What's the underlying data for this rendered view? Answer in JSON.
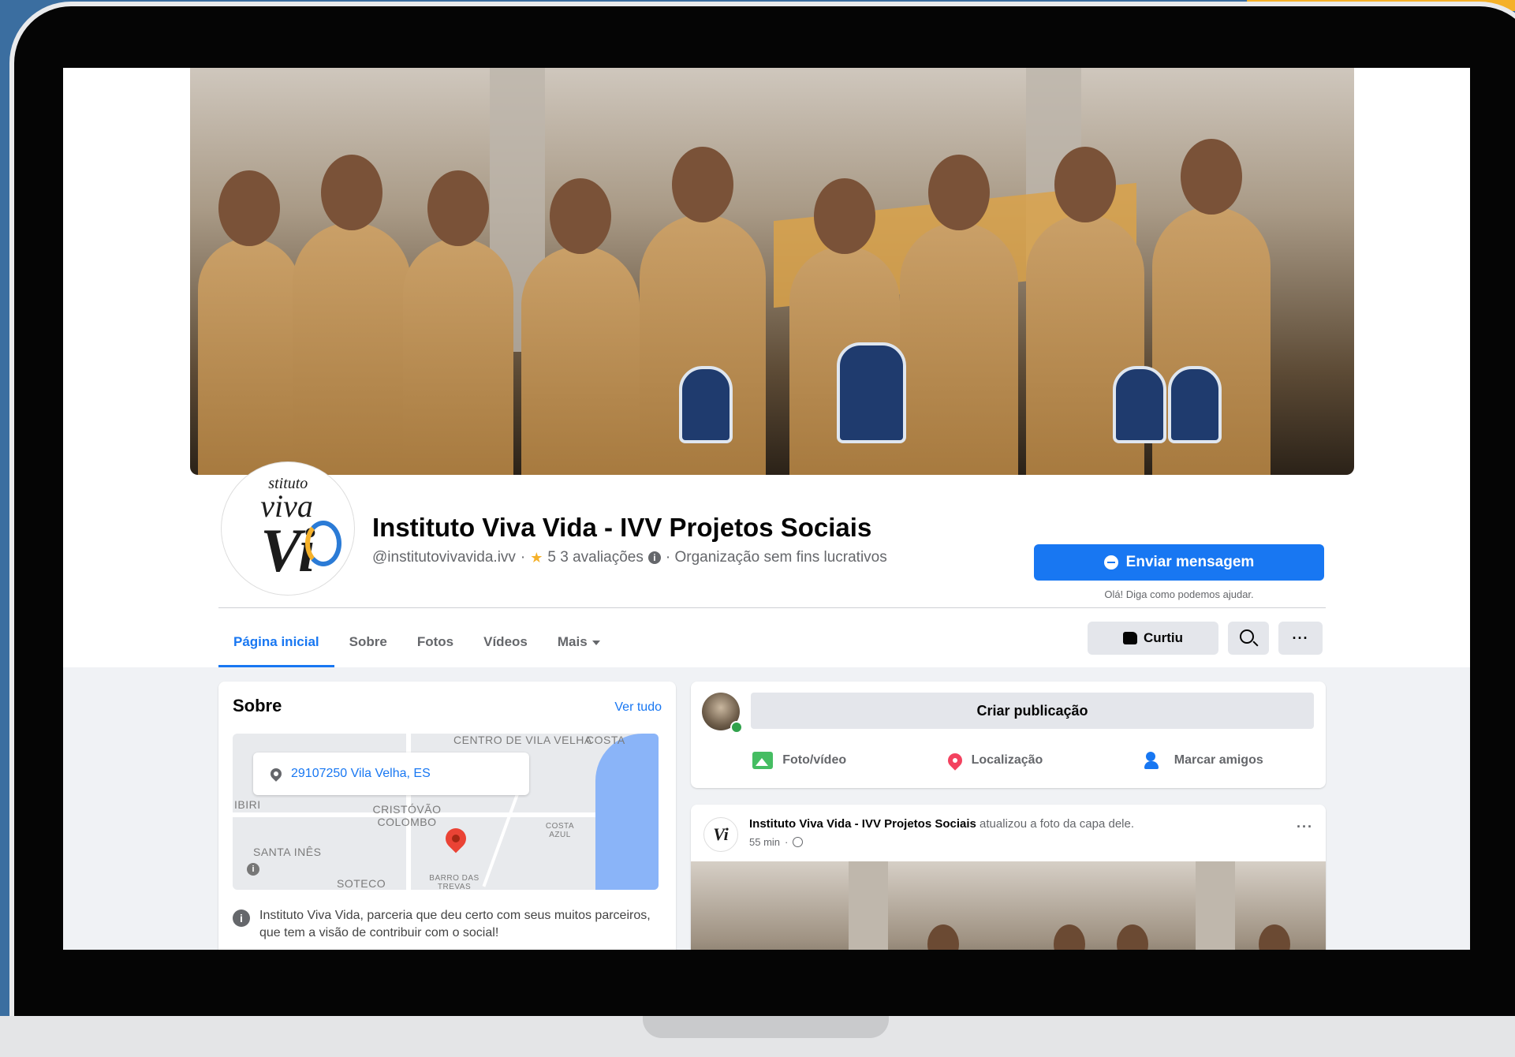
{
  "colors": {
    "background": "#3b6ea0",
    "accent": "#f5b12a",
    "facebook_blue": "#1877f2",
    "jersey": "#c89a5f"
  },
  "page": {
    "avatar_logo_text": [
      "stituto",
      "viva",
      "Vi"
    ],
    "name": "Instituto Viva Vida - IVV Projetos Sociais",
    "handle": "@institutovivavida.ivv",
    "separator": "·",
    "rating_icon": "star-icon",
    "rating_text": "5 3 avaliações",
    "category": "· Organização sem fins lucrativos"
  },
  "actions": {
    "send_message_label": "Enviar mensagem",
    "send_message_hint": "Olá! Diga como podemos ajudar.",
    "liked_label": "Curtiu",
    "search_icon": "search-icon",
    "more_label": "···"
  },
  "tabs": [
    {
      "label": "Página inicial",
      "active": true
    },
    {
      "label": "Sobre",
      "active": false
    },
    {
      "label": "Fotos",
      "active": false
    },
    {
      "label": "Vídeos",
      "active": false
    },
    {
      "label": "Mais",
      "active": false
    }
  ],
  "about": {
    "title": "Sobre",
    "see_all": "Ver tudo",
    "address": "29107250 Vila Velha, ES",
    "map_labels": [
      "CENTRO DE VILA VELHA",
      "COSTA",
      "IBIRI",
      "CRISTÓVÃO COLOMBO",
      "COSTA AZUL",
      "SANTA INÊS",
      "SOTECO",
      "BARRO DAS TREVAS"
    ],
    "description": "Instituto Viva Vida, parceria que deu certo com seus muitos parceiros, que tem a visão de contribuir com o social!"
  },
  "composer": {
    "placeholder": "Criar publicação",
    "photo_video": "Foto/vídeo",
    "location": "Localização",
    "tag_friends": "Marcar amigos"
  },
  "post": {
    "avatar_logo_text": "Vi",
    "author": "Instituto Viva Vida - IVV Projetos Sociais",
    "action": "atualizou a foto da capa dele.",
    "time": "55 min",
    "more_label": "···"
  }
}
